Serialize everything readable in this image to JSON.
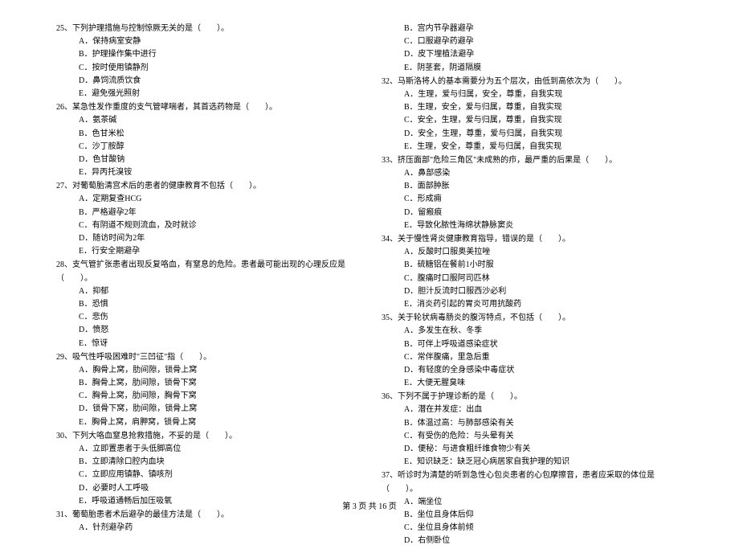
{
  "footer": "第 3 页 共 16 页",
  "blank": "（　　）。",
  "left": [
    {
      "num": "25、",
      "text": "下列护理措施与控制惊厥无关的是",
      "opts": [
        "A．保持病室安静",
        "B．护理操作集中进行",
        "C．按时使用镇静剂",
        "D．鼻饲流质饮食",
        "E．避免强光照射"
      ]
    },
    {
      "num": "26、",
      "text": "某急性发作重度的支气管哮喘者，其首选药物是",
      "opts": [
        "A．氨茶碱",
        "B．色甘米松",
        "C．沙丁胺醇",
        "D．色甘酸钠",
        "E．异丙托溴铵"
      ]
    },
    {
      "num": "27、",
      "text": "对葡萄胎清宫术后的患者的健康教育不包括",
      "opts": [
        "A．定期复查HCG",
        "B．严格避孕2年",
        "C．有阴道不规则流血，及时就诊",
        "D．随访时间为2年",
        "E．行安全期避孕"
      ]
    },
    {
      "num": "28、",
      "text": "支气管扩张患者出现反复咯血，有窒息的危险。患者最可能出现的心理反应是",
      "opts": [
        "A．抑郁",
        "B．恐惧",
        "C．悲伤",
        "D．愤怒",
        "E．惊讶"
      ]
    },
    {
      "num": "29、",
      "text": "吸气性呼吸困难时\"三凹征\"指",
      "opts": [
        "A．胸骨上窝，肋间隙，锁骨上窝",
        "B．胸骨上窝，肋间隙，锁骨下窝",
        "C．胸骨上窝，肋间隙，胸骨下窝",
        "D．锁骨下窝，肋间隙，锁骨上窝",
        "E．胸骨上窝，肩胛窝，锁骨上窝"
      ]
    },
    {
      "num": "30、",
      "text": "下列大咯血窒息抢救措施，不妥的是",
      "opts": [
        "A．立即置患者于头低脚高位",
        "B．立即清除口腔内血块",
        "C．立即应用镇静、镇咳剂",
        "D．必要时人工呼吸",
        "E．呼吸道通畅后加压吸氧"
      ]
    },
    {
      "num": "31、",
      "text": "葡萄胎患者术后避孕的最佳方法是",
      "opts": [
        "A．针剂避孕药"
      ]
    }
  ],
  "right": [
    {
      "num": "",
      "text": "",
      "opts": [
        "B．宫内节孕器避孕",
        "C．口服避孕药避孕",
        "D．皮下埋植法避孕",
        "E．阴茎套，阴道隔膜"
      ]
    },
    {
      "num": "32、",
      "text": "马斯洛将人的基本需要分为五个层次，由低到高依次为",
      "opts": [
        "A．生理，爱与归属，安全，尊重，自我实现",
        "B．生理，安全，爱与归属，尊重，自我实现",
        "C．安全，生理，爱与归属，尊重，自我实现",
        "D．安全，生理，尊重，爱与归属，自我实现",
        "E．生理，安全，尊重，爱与归属，自我实现"
      ]
    },
    {
      "num": "33、",
      "text": "挤压面部\"危险三角区\"未成熟的疖，最严重的后果是",
      "opts": [
        "A．鼻部感染",
        "B．面部肿胀",
        "C．形成痈",
        "D．留瘢痕",
        "E．导致化脓性海绵状静脉窦炎"
      ]
    },
    {
      "num": "34、",
      "text": "关于慢性肾炎健康教育指导，错误的是",
      "opts": [
        "A．反酸时口服奥美拉唑",
        "B．硫糖铝在餐前1小时服",
        "C．腹痛时口服阿司匹林",
        "D．胆汁反流时口服西沙必利",
        "E．消炎药引起的胃炎可用抗酸药"
      ]
    },
    {
      "num": "35、",
      "text": "关于轮状病毒肠炎的腹泻特点，不包括",
      "opts": [
        "A．多发生在秋、冬季",
        "B．可伴上呼吸道感染症状",
        "C．常伴腹痛，里急后重",
        "D．有轻度的全身感染中毒症状",
        "E．大便无腥臭味"
      ]
    },
    {
      "num": "36、",
      "text": "下列不属于护理诊断的是",
      "opts": [
        "A．潜在并发症：出血",
        "B．体温过高：与肺部感染有关",
        "C．有受伤的危险：与头晕有关",
        "D．便秘：与进食粗纤维食物少有关",
        "E．知识缺乏：缺乏冠心病居家自我护理的知识"
      ]
    },
    {
      "num": "37、",
      "text": "听诊时为清楚的听到急性心包炎患者的心包摩擦音，患者应采取的体位是",
      "opts": [
        "A．端坐位",
        "B．坐位且身体后仰",
        "C．坐位且身体前倾",
        "D．右侧卧位"
      ]
    }
  ]
}
